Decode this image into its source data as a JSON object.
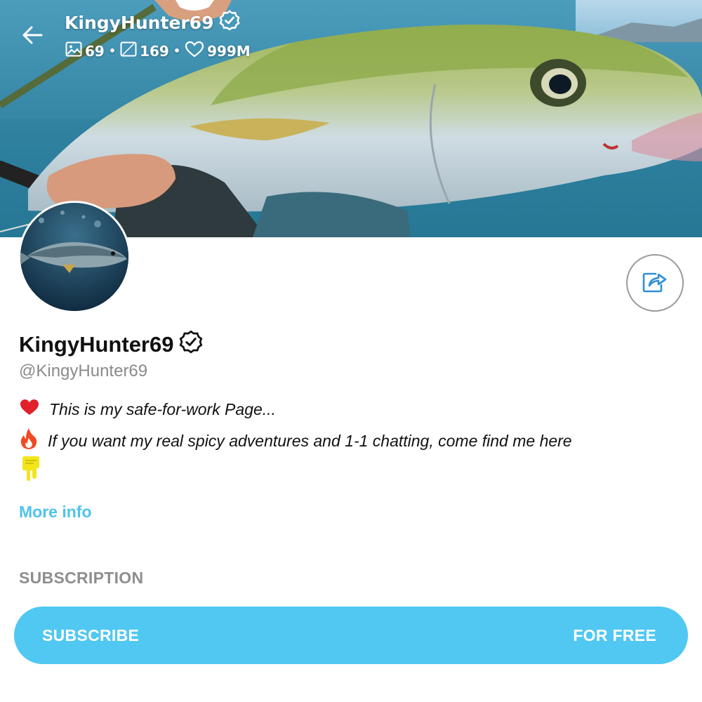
{
  "header": {
    "title": "KingyHunter69",
    "stats": {
      "photos": "69",
      "videos": "169",
      "likes": "999M"
    }
  },
  "profile": {
    "name": "KingyHunter69",
    "handle": "@KingyHunter69",
    "verified": true,
    "bio": [
      {
        "emoji": "heart",
        "text": "This is my safe-for-work Page..."
      },
      {
        "emoji": "fire",
        "text": "If you want my real spicy adventures and 1-1 chatting, come find me here"
      }
    ],
    "more_info_label": "More info"
  },
  "subscription": {
    "section_label": "SUBSCRIPTION",
    "button_label": "SUBSCRIBE",
    "price_label": "FOR FREE"
  },
  "colors": {
    "accent": "#50c8f2",
    "link": "#4fc3ec",
    "muted": "#8e8e8e",
    "heart": "#e0202b",
    "fire": "#f04a24",
    "drip": "#f2e51a"
  },
  "icons": {
    "back": "arrow-left-icon",
    "verified": "verified-badge-icon",
    "photos": "image-icon",
    "videos": "video-icon",
    "likes": "heart-outline-icon",
    "share": "share-icon"
  }
}
